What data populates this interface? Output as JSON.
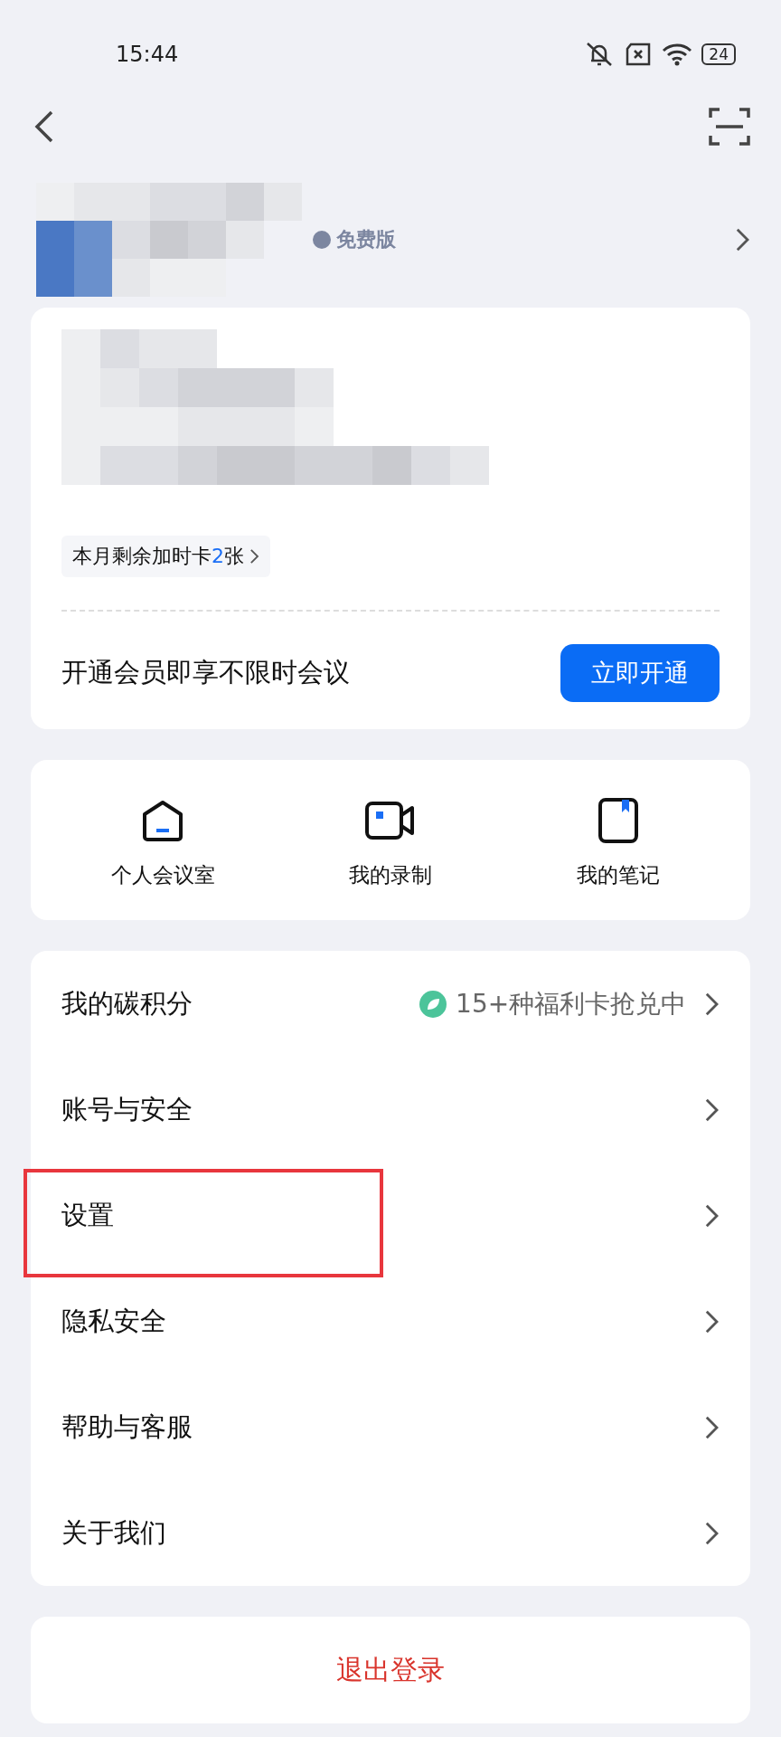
{
  "status_bar": {
    "time": "15:44",
    "battery": "24"
  },
  "profile": {
    "edition": "免费版"
  },
  "membership_card": {
    "extra_time_prefix": "本月剩余加时卡",
    "extra_time_count": "2",
    "extra_time_suffix": "张",
    "promo": "开通会员即享不限时会议",
    "cta": "立即开通"
  },
  "shortcuts": [
    {
      "kind": "room",
      "label": "个人会议室"
    },
    {
      "kind": "recording",
      "label": "我的录制"
    },
    {
      "kind": "notes",
      "label": "我的笔记"
    }
  ],
  "menu": [
    {
      "label": "我的碳积分",
      "detail": "15+种福利卡抢兑中",
      "highlighted": false
    },
    {
      "label": "账号与安全",
      "highlighted": false
    },
    {
      "label": "设置",
      "highlighted": true
    },
    {
      "label": "隐私安全",
      "highlighted": false
    },
    {
      "label": "帮助与客服",
      "highlighted": false
    },
    {
      "label": "关于我们",
      "highlighted": false
    }
  ],
  "logout": "退出登录"
}
